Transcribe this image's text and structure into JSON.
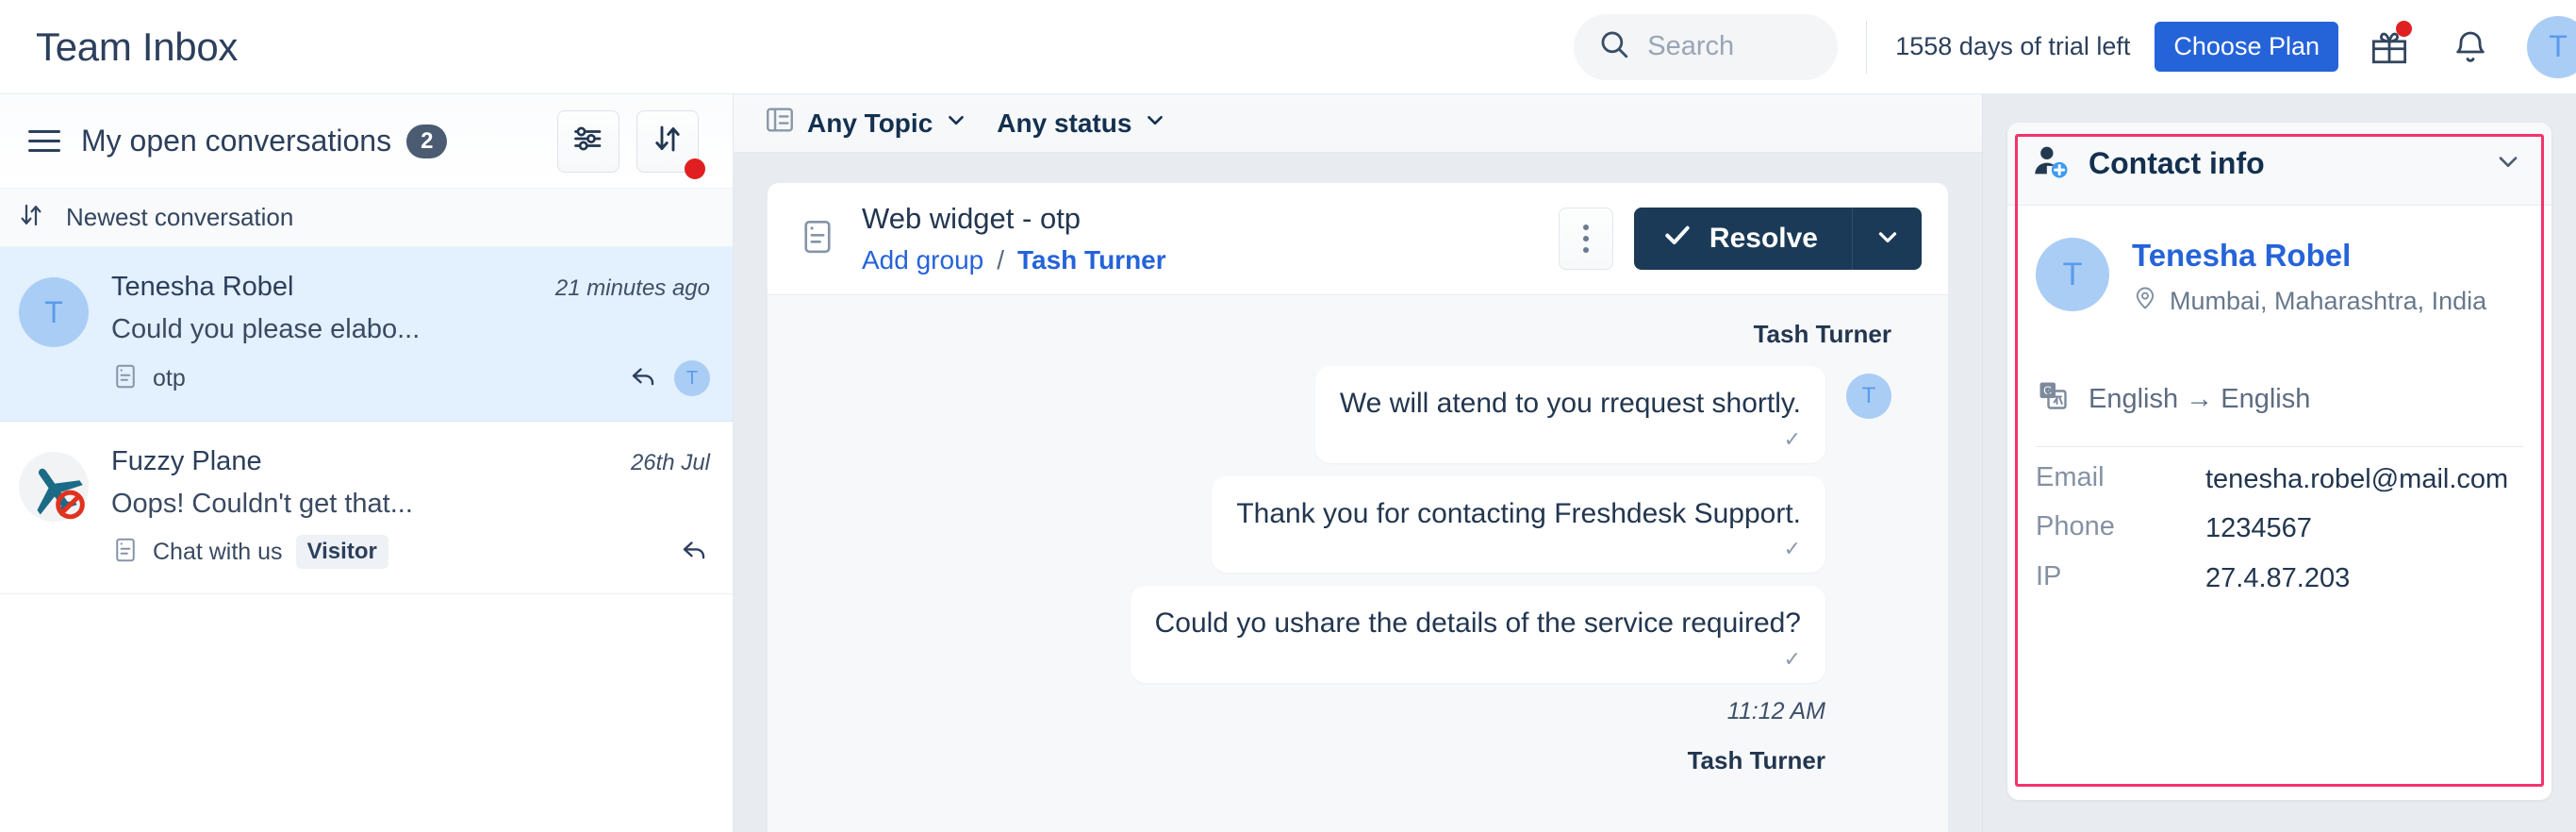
{
  "header": {
    "app_title": "Team Inbox",
    "search_placeholder": "Search",
    "trial_text": "1558 days of trial left",
    "choose_plan_label": "Choose Plan",
    "gift_icon": "gift-icon",
    "bell_icon": "bell-icon",
    "avatar_initial": "T"
  },
  "sidebar": {
    "title": "My open conversations",
    "count": "2",
    "sort_label": "Newest conversation",
    "conversations": [
      {
        "avatar_initial": "T",
        "name": "Tenesha Robel",
        "time": "21 minutes ago",
        "snippet": "Could you please elabo...",
        "source": "otp",
        "tag": "",
        "reply_avatar": "T",
        "active": true
      },
      {
        "avatar_initial": "",
        "name": "Fuzzy Plane",
        "time": "26th Jul",
        "snippet": "Oops! Couldn't get that...",
        "source": "Chat with us",
        "tag": "Visitor",
        "reply_avatar": "",
        "active": false
      }
    ]
  },
  "main": {
    "filters": [
      {
        "label": "Any Topic"
      },
      {
        "label": "Any status"
      }
    ],
    "conversation": {
      "title": "Web widget - otp",
      "add_group_label": "Add group",
      "separator": "/",
      "assignee": "Tash Turner",
      "resolve_label": "Resolve"
    },
    "messages": {
      "author": "Tash Turner",
      "avatar_initial": "T",
      "bubbles": [
        {
          "text": "We will atend to you rrequest shortly."
        },
        {
          "text": "Thank you for contacting Freshdesk Support."
        },
        {
          "text": "Could yo ushare the details of the service required?"
        }
      ],
      "time": "11:12 AM",
      "next_author": "Tash Turner"
    }
  },
  "right_panel": {
    "card_title": "Contact info",
    "avatar_initial": "T",
    "contact_name": "Tenesha Robel",
    "location": "Mumbai, Maharashtra, India",
    "language": "English → English",
    "fields": [
      {
        "key": "Email",
        "value": "tenesha.robel@mail.com"
      },
      {
        "key": "Phone",
        "value": "1234567"
      },
      {
        "key": "IP",
        "value": "27.4.87.203"
      }
    ]
  }
}
